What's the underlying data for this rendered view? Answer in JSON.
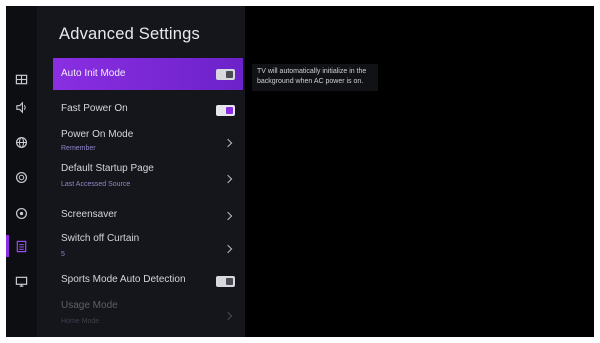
{
  "panel": {
    "title": "Advanced Settings"
  },
  "rail": {
    "icons": [
      "picture-icon",
      "sound-icon",
      "network-icon",
      "accessibility-icon",
      "general-settings-icon",
      "advanced-settings-icon",
      "cast-icon"
    ],
    "active": "advanced-settings-icon"
  },
  "items": {
    "auto_init": {
      "label": "Auto Init Mode",
      "toggle": "on"
    },
    "fast_power": {
      "label": "Fast Power On",
      "toggle": "on"
    },
    "power_on_mode": {
      "label": "Power On Mode",
      "value": "Remember"
    },
    "default_startup": {
      "label": "Default Startup Page",
      "value": "Last Accessed Source"
    },
    "screensaver": {
      "label": "Screensaver"
    },
    "switch_off_curtain": {
      "label": "Switch off Curtain",
      "value": "5"
    },
    "sports_mode": {
      "label": "Sports Mode Auto Detection",
      "toggle": "off"
    },
    "usage_mode": {
      "label": "Usage Mode",
      "value": "Home Mode"
    }
  },
  "help": {
    "text": "TV will automatically initialize in the background when AC power is on."
  },
  "colors": {
    "accent": "#8a2ee2",
    "background": "#000000",
    "panel": "#15161c"
  }
}
